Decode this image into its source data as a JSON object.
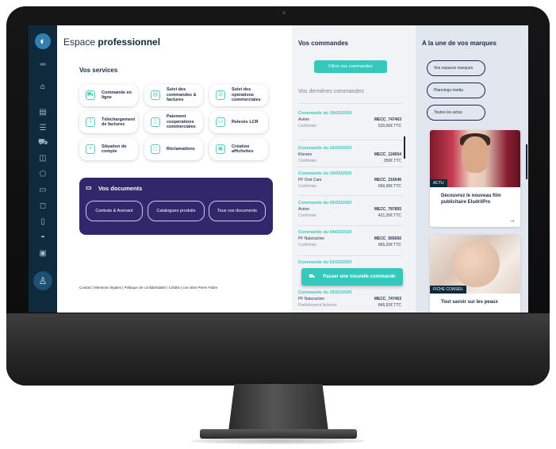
{
  "app": {
    "title_prefix": "Espace",
    "title_bold": "professionnel"
  },
  "sidebar": {
    "icons": [
      "home-icon",
      "document-icon",
      "list-icon",
      "cart-icon",
      "box-icon",
      "tag-icon",
      "card-icon",
      "chat-icon",
      "file-icon",
      "dashboard-icon",
      "media-icon"
    ]
  },
  "services": {
    "title": "Vos services",
    "items": [
      {
        "label": "Commande en ligne"
      },
      {
        "label": "Suivi des commandes & factures"
      },
      {
        "label": "Suivi des opérations commerciales"
      },
      {
        "label": "Téléchargement de factures"
      },
      {
        "label": "Paiement coopérations commerciales"
      },
      {
        "label": "Relevés LCR"
      },
      {
        "label": "Situation de compte"
      },
      {
        "label": "Réclamations"
      },
      {
        "label": "Création affichettes"
      }
    ]
  },
  "documents": {
    "title": "Vos documents",
    "buttons": [
      "Contrats & Avenant",
      "Catalogues produits",
      "Tous vos documents"
    ]
  },
  "footer": "Contact | Mentions légales | Politique de confidentialité | Crédits | Les sites Pierre Fabre",
  "orders": {
    "title": "Vos commandes",
    "filter": "Filtrer vos commandes",
    "recent": "Vos dernières commandes",
    "new_order": "Passer une nouvelle commande",
    "items": [
      {
        "date": "Commande du 18/03/2020",
        "brand": "Avène",
        "ref": "MECC_747463",
        "status": "Confirmée",
        "amount": "520,00€ TTC"
      },
      {
        "date": "Commande du 16/03/2020",
        "brand": "Klorane",
        "ref": "MECC_124654",
        "status": "Confirmée",
        "amount": "250€ TTC"
      },
      {
        "date": "Commande du 10/03/2020",
        "brand": "PF Oral Care",
        "ref": "MECC_216546",
        "status": "Confirmée",
        "amount": "666,99€ TTC"
      },
      {
        "date": "Commande du 05/03/2020",
        "brand": "Avène",
        "ref": "MECC_787855",
        "status": "Confirmée",
        "amount": "421,20€ TTC"
      },
      {
        "date": "Commande du 04/03/2020",
        "brand": "PF Naturactive",
        "ref": "MECC_565656",
        "status": "Confirmée",
        "amount": "965,20€ TTC"
      },
      {
        "date": "Commande du 01/03/2020",
        "brand": "",
        "ref": "",
        "status": "",
        "amount": ""
      },
      {
        "date": "Commande du 25/02/2020",
        "brand": "PF Naturactive",
        "ref": "MECC_747463",
        "status": "Partiellement facturée",
        "amount": "845,52€ TTC"
      }
    ]
  },
  "brands": {
    "title": "A la une de vos marques",
    "buttons": [
      "Vos espaces marques",
      "Plannings media",
      "Toutes les actus"
    ],
    "cards": [
      {
        "tag": "ACTU",
        "text": "Découvrez le nouveau film publicitaire EludrilPro"
      },
      {
        "tag": "FICHE CONSEIL",
        "text": "Tout savoir sur les peaux"
      }
    ]
  },
  "colors": {
    "accent": "#35c9bd",
    "navy": "#0e2a3c",
    "purple": "#32276a"
  }
}
